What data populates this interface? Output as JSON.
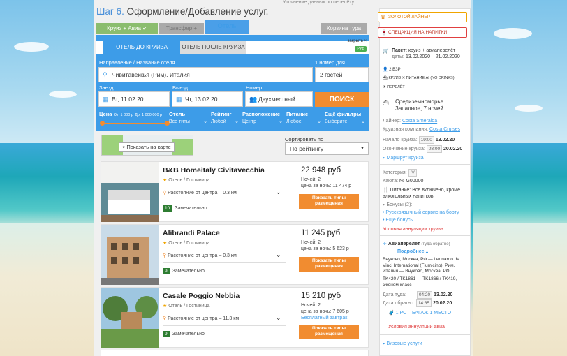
{
  "top_note": "Уточнение данных по перелёту",
  "step": {
    "num": "Шаг 6.",
    "title": "Оформление/Добавление услуг."
  },
  "tabs": {
    "cruise_avia": "Круиз + Авиа",
    "transfer": "Трансфер +",
    "hotel": "Отель",
    "cart": "Корзина тура"
  },
  "subtabs": {
    "before": "ОТЕЛЬ ДО КРУИЗА",
    "after": "ОТЕЛЬ ПОСЛЕ КРУИЗА",
    "close": "закрыть ×",
    "currency": "РУБ"
  },
  "search": {
    "dest_label": "Направление / Название отеля",
    "dest_value": "Чивитавеккья (Рим), Италия",
    "room_label": "1 номер для",
    "room_value": "2 гостей",
    "checkin_label": "Заезд",
    "checkin_value": "Вт, 11.02.20",
    "checkout_label": "Выезд",
    "checkout_value": "Чт, 13.02.20",
    "number_label": "Номер",
    "number_value": "Двухместный",
    "button": "ПОИСК"
  },
  "filters": {
    "price_label": "Цена",
    "price_from": "От: 1 000 р",
    "price_to": "До: 1 000 000 р",
    "hotel_label": "Отель",
    "hotel_value": "Все типы",
    "rating_label": "Рейтинг",
    "rating_value": "Любой",
    "location_label": "Расположение",
    "location_value": "Центр",
    "food_label": "Питание",
    "food_value": "Любое",
    "more_label": "Ещё фильтры",
    "more_value": "Выберите"
  },
  "map_button": "Показать на карте",
  "sort": {
    "label": "Сортировать по",
    "value": "По рейтингу"
  },
  "hotels": [
    {
      "name": "B&B Homeitaly Civitavecchia",
      "type": "Отель / Гостиница",
      "distance": "Расстояние от центра – 0.3 км",
      "score": "10",
      "score_text": "Замечательно",
      "price": "22 948 руб",
      "nights": "Ночей: 2",
      "per_night": "цена за ночь: 11 474 р",
      "breakfast": "",
      "button": "Показать типы размещения"
    },
    {
      "name": "Alibrandi Palace",
      "type": "Отель / Гостиница",
      "distance": "Расстояние от центра – 0.3 км",
      "score": "9",
      "score_text": "Замечательно",
      "price": "11 245 руб",
      "nights": "Ночей: 2",
      "per_night": "цена за ночь: 5 623 р",
      "breakfast": "",
      "button": "Показать типы размещения"
    },
    {
      "name": "Casale Poggio Nebbia",
      "type": "Отель / Гостиница",
      "distance": "Расстояние от центра – 11.3 км",
      "score": "9",
      "score_text": "Замечательно",
      "price": "15 210 руб",
      "nights": "Ночей: 2",
      "per_night": "цена за ночь: 7 605 р",
      "breakfast": "Бесплатный завтрак",
      "button": "Показать типы размещения"
    }
  ],
  "right": {
    "promo1": "ЗОЛОТОЙ ЛАЙНЕР",
    "promo2": "СПЕЦАКЦИЯ НА НАПИТКИ",
    "package": "Пакет:",
    "package_value": "круиз + авиаперелёт",
    "dates_label": "даты:",
    "dates": "13.02.2020 – 21.02.2020",
    "adults": "2 ВЗР",
    "cruise": "КРУИЗ",
    "drinks": "ПИТАНИЕ AI (NO DRINKS)",
    "flight": "ПЕРЕЛЁТ",
    "route": "Средиземноморье Западное, 7 ночей",
    "liner_label": "Лайнер:",
    "liner": "Costa Smeralda",
    "company_label": "Круизная компания:",
    "company": "Costa Cruises",
    "start_label": "Начало круиза:",
    "start_time": "19:00",
    "start_date": "13.02.20",
    "end_label": "Окончание круиза:",
    "end_time": "08:00",
    "end_date": "20.02.20",
    "route_link": "Маршрут круиза",
    "category_label": "Категория:",
    "category": "IV",
    "cabin_label": "Каюта:",
    "cabin": "№ G00000",
    "food": "Питание: Всё включено, кроме алкогольных напитков",
    "bonus": "Бонусы (2):",
    "service": "Русскоязычный сервис на борту",
    "more_link": "Ещё бонусы",
    "cancel_cruise": "Условия аннуляции круиза",
    "avia": "Авиаперелёт",
    "avia_type": "(туда-обратно)",
    "details": "Подробнее...",
    "avia_route": "Внуково, Москва, РФ — Leonardo da Vinci International (Fiumicino), Рим, Италия — Внуково, Москва, РФ",
    "flights": "TK420 / TK1861 — TK1866 / TK419, Эконом класс",
    "there_label": "Дата туда:",
    "there_time": "04:20",
    "there_date": "13.02.20",
    "back_label": "Дата обратно:",
    "back_time": "14:35",
    "back_date": "20.02.20",
    "baggage": "1 РС – БАГАЖ 1 МЕСТО",
    "cancel_avia": "Условия аннуляции авиа",
    "visa": "Визовые услуги"
  }
}
